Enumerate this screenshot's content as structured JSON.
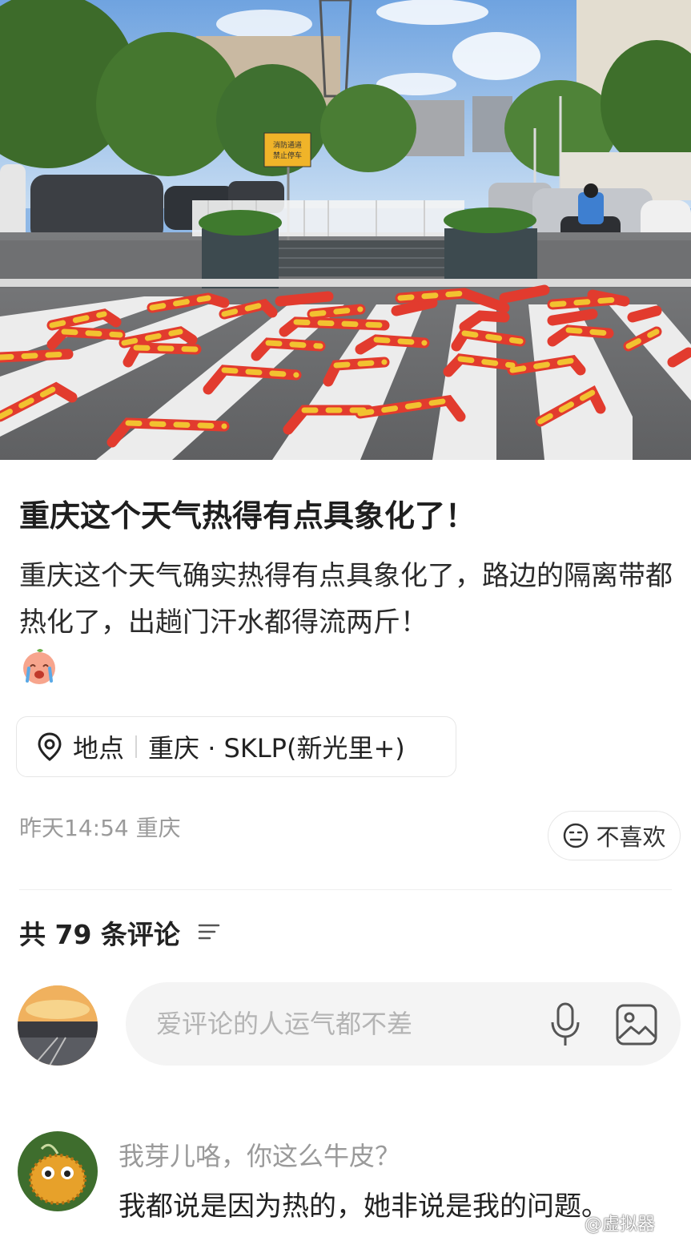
{
  "post": {
    "title": "重庆这个天气热得有点具象化了！",
    "body": "重庆这个天气确实热得有点具象化了，路边的隔离带都热化了，出趟门汗水都得流两斤！",
    "emoji": "crying-face"
  },
  "photo": {
    "sign_text": [
      "消防通道",
      "禁止停车"
    ]
  },
  "location": {
    "label": "地点",
    "place": "重庆 · SKLP(新光里+)"
  },
  "meta": {
    "time_location": "昨天14:54 重庆",
    "dislike_label": "不喜欢"
  },
  "comments": {
    "count_label": "共 79 条评论",
    "input_placeholder": "爱评论的人运气都不差",
    "items": [
      {
        "user": "我芽儿咯，你这么牛皮？",
        "text": "我都说是因为热的，她非说是我的问题。"
      }
    ]
  },
  "watermark": "@虚拟器",
  "colors": {
    "bollard_red": "#e23b2e",
    "bollard_yellow": "#f2c230",
    "text_primary": "#222222",
    "text_secondary": "#9a9a9a",
    "input_bg": "#f4f4f4"
  }
}
